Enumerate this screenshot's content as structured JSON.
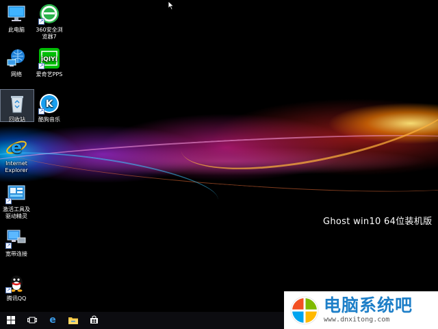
{
  "desktop": {
    "icons": [
      {
        "label": "此电脑",
        "icon": "computer-icon"
      },
      {
        "label": "360安全浏览器7",
        "icon": "360-browser-icon"
      },
      {
        "label": "网络",
        "icon": "network-icon"
      },
      {
        "label": "爱奇艺PPS",
        "icon": "iqiyi-icon"
      },
      {
        "label": "回收站",
        "icon": "recycle-bin-icon"
      },
      {
        "label": "酷狗音乐",
        "icon": "kugou-icon"
      },
      {
        "label": "Internet Explorer",
        "icon": "ie-icon"
      },
      {
        "label": "激活工具及驱动精灵",
        "icon": "driver-tool-icon"
      },
      {
        "label": "宽带连接",
        "icon": "broadband-icon"
      },
      {
        "label": "腾讯QQ",
        "icon": "qq-icon"
      }
    ],
    "wallpaper_text": "Ghost  win10  64位装机版"
  },
  "taskbar": {
    "buttons": [
      "start-icon",
      "task-view-icon",
      "edge-icon",
      "file-explorer-icon",
      "store-icon"
    ]
  },
  "brand": {
    "name": "电脑系统吧",
    "url": "www.dnxitong.com",
    "logo_colors": [
      "#f25022",
      "#7fba00",
      "#00a4ef",
      "#ffb900"
    ]
  }
}
